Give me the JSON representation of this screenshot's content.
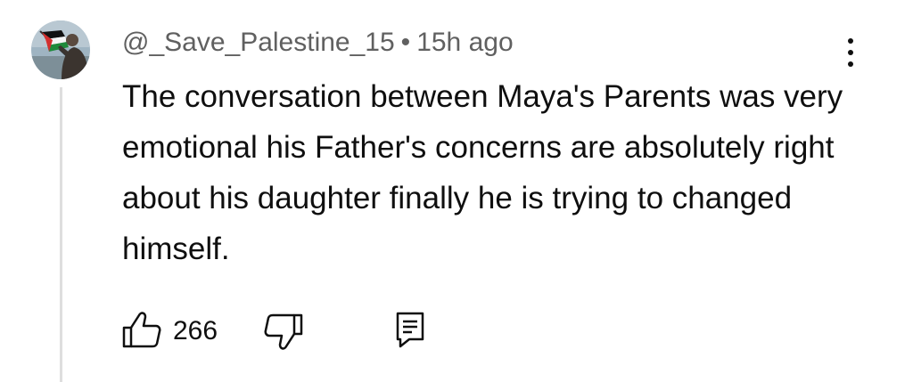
{
  "comment": {
    "author": "@_Save_Palestine_15",
    "separator": "•",
    "timestamp": "15h ago",
    "text": "The conversation between Maya's Parents was very emotional his Father's concerns are absolutely right about his daughter finally he is trying to changed himself.",
    "like_count": "266"
  },
  "icons": {
    "avatar": "profile-picture-with-flag",
    "more": "vertical-ellipsis-icon",
    "like": "thumbs-up-icon",
    "dislike": "thumbs-down-icon",
    "reply": "reply-comment-icon"
  },
  "colors": {
    "text_primary": "#0f0f0f",
    "text_secondary": "#606060",
    "thread_line": "#dedede"
  }
}
